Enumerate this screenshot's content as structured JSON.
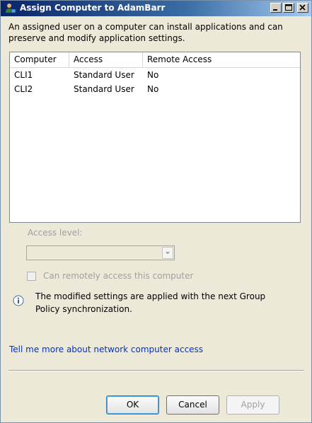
{
  "window": {
    "title": "Assign Computer to AdamBarr"
  },
  "description": {
    "line1": "An assigned user on a computer can install applications and can",
    "line2": "preserve and modify application settings."
  },
  "table": {
    "columns": [
      "Computer",
      "Access",
      "Remote Access"
    ],
    "rows": [
      [
        "CLI1",
        "Standard User",
        "No"
      ],
      [
        "CLI2",
        "Standard User",
        "No"
      ]
    ]
  },
  "access_level": {
    "label": "Access level:",
    "selected": ""
  },
  "remote_checkbox": {
    "label": "Can remotely access this computer",
    "checked": false
  },
  "info": {
    "line1": "The modified settings are applied with the next Group",
    "line2": "Policy synchronization."
  },
  "link_text": "Tell me more about network computer access",
  "buttons": {
    "ok": "OK",
    "cancel": "Cancel",
    "apply": "Apply"
  }
}
